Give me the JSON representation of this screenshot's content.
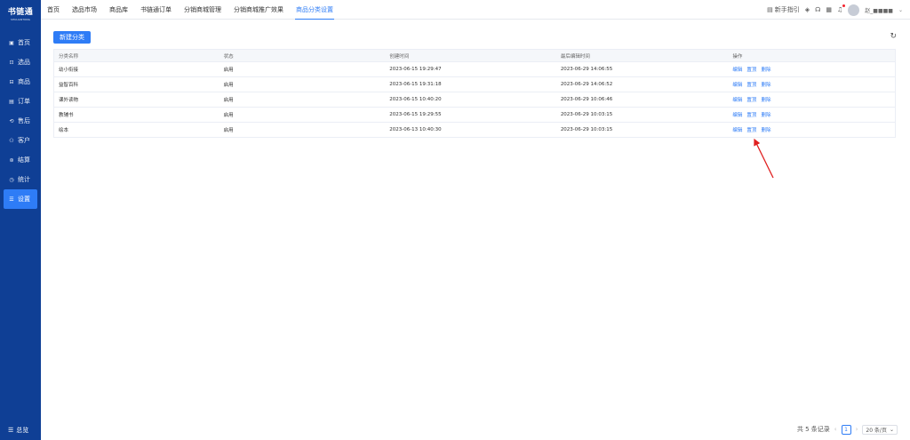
{
  "sidebar": {
    "logo": "书链通",
    "logo_sub": "SHULIANTONG",
    "items": [
      {
        "icon": "home-icon",
        "glyph": "▣",
        "label": "首页",
        "active": false
      },
      {
        "icon": "select-icon",
        "glyph": "⊡",
        "label": "选品",
        "active": false
      },
      {
        "icon": "product-icon",
        "glyph": "⊟",
        "label": "商品",
        "active": false
      },
      {
        "icon": "order-icon",
        "glyph": "▤",
        "label": "订单",
        "active": false
      },
      {
        "icon": "aftersale-icon",
        "glyph": "⟲",
        "label": "售后",
        "active": false
      },
      {
        "icon": "customer-icon",
        "glyph": "⚇",
        "label": "客户",
        "active": false
      },
      {
        "icon": "settle-icon",
        "glyph": "⊛",
        "label": "结算",
        "active": false
      },
      {
        "icon": "stats-icon",
        "glyph": "◷",
        "label": "统计",
        "active": false
      },
      {
        "icon": "settings-icon",
        "glyph": "☰",
        "label": "设置",
        "active": true
      }
    ],
    "bottom_label": "总览"
  },
  "topbar": {
    "tabs": [
      {
        "label": "首页",
        "active": false
      },
      {
        "label": "选品市场",
        "active": false
      },
      {
        "label": "商品库",
        "active": false
      },
      {
        "label": "书链通订单",
        "active": false
      },
      {
        "label": "分销商城管理",
        "active": false
      },
      {
        "label": "分销商城推广效果",
        "active": false
      },
      {
        "label": "商品分类设置",
        "active": true
      }
    ],
    "guide_label": "新手指引",
    "username": "赵_■■■■"
  },
  "main": {
    "new_button": "新建分类",
    "columns": [
      "分类名称",
      "状态",
      "创建时间",
      "最后编辑时间",
      "操作"
    ],
    "rows": [
      {
        "name": "幼小衔接",
        "status": "启用",
        "created": "2023-06-15 19:29:47",
        "edited": "2023-06-29 14:06:55"
      },
      {
        "name": "益智百科",
        "status": "启用",
        "created": "2023-06-15 19:31:18",
        "edited": "2023-06-29 14:06:52"
      },
      {
        "name": "课外读物",
        "status": "启用",
        "created": "2023-06-15 10:40:20",
        "edited": "2023-06-29 10:06:46"
      },
      {
        "name": "教辅书",
        "status": "启用",
        "created": "2023-06-15 19:29:55",
        "edited": "2023-06-29 10:03:15"
      },
      {
        "name": "绘本",
        "status": "启用",
        "created": "2023-06-13 10:40:30",
        "edited": "2023-06-29 10:03:15"
      }
    ],
    "actions": [
      "编辑",
      "置顶",
      "删除"
    ]
  },
  "pagination": {
    "total_text": "共 5 条记录",
    "current_page": "1",
    "page_size": "20 条/页"
  },
  "colors": {
    "sidebar": "#0f3f95",
    "accent": "#2e7cf6",
    "annotation_arrow": "#e02020"
  }
}
